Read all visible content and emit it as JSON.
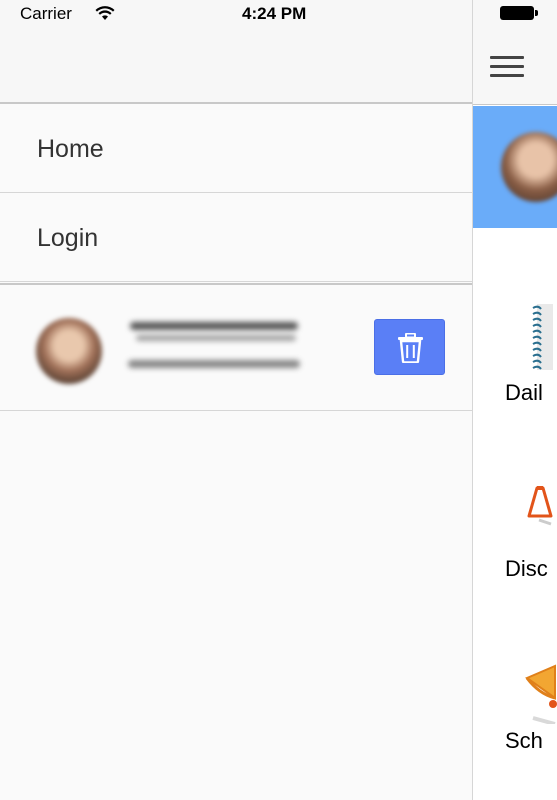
{
  "status_bar": {
    "carrier": "Carrier",
    "time": "4:24 PM",
    "wifi_icon": "wifi-icon",
    "battery_icon": "battery-full-icon"
  },
  "side_menu": {
    "items": [
      {
        "label": "Home"
      },
      {
        "label": "Login"
      }
    ],
    "account": {
      "avatar": "user-avatar-blurred",
      "delete_icon": "trash-icon",
      "delete_button_color": "#5a7ff6"
    }
  },
  "main_page": {
    "menu_icon": "hamburger-menu-icon",
    "banner_color": "#6aacf9",
    "items": [
      {
        "label": "Dail",
        "icon": "notebook-icon"
      },
      {
        "label": "Disc",
        "icon": "flask-icon"
      },
      {
        "label": "Sch",
        "icon": "bell-icon"
      }
    ]
  }
}
